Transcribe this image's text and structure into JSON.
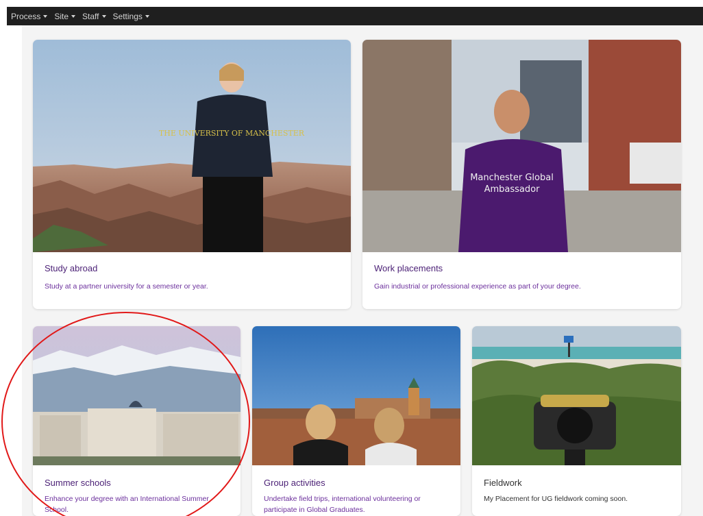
{
  "nav": {
    "items": [
      {
        "label": "Process"
      },
      {
        "label": "Site"
      },
      {
        "label": "Staff"
      },
      {
        "label": "Settings"
      }
    ]
  },
  "cards": [
    {
      "title": "Study abroad",
      "description": "Study at a partner university for a semester or year."
    },
    {
      "title": "Work placements",
      "description": "Gain industrial or professional experience as part of your degree."
    },
    {
      "title": "Summer schools",
      "description": "Enhance your degree with an International Summer School."
    },
    {
      "title": "Group activities",
      "description": "Undertake field trips, international volunteering or participate in Global Graduates."
    },
    {
      "title": "Fieldwork",
      "description": "My Placement for UG fieldwork coming soon."
    }
  ],
  "images": {
    "study_abroad_shirt": "THE UNIVERSITY OF MANCHESTER",
    "work_placement_shirt_line1": "Manchester Global",
    "work_placement_shirt_line2": "Ambassador"
  },
  "colors": {
    "navbar_bg": "#1f1f1f",
    "title_purple": "#4a1f75",
    "desc_purple": "#6b2f9c",
    "annotation_red": "#e11818"
  }
}
